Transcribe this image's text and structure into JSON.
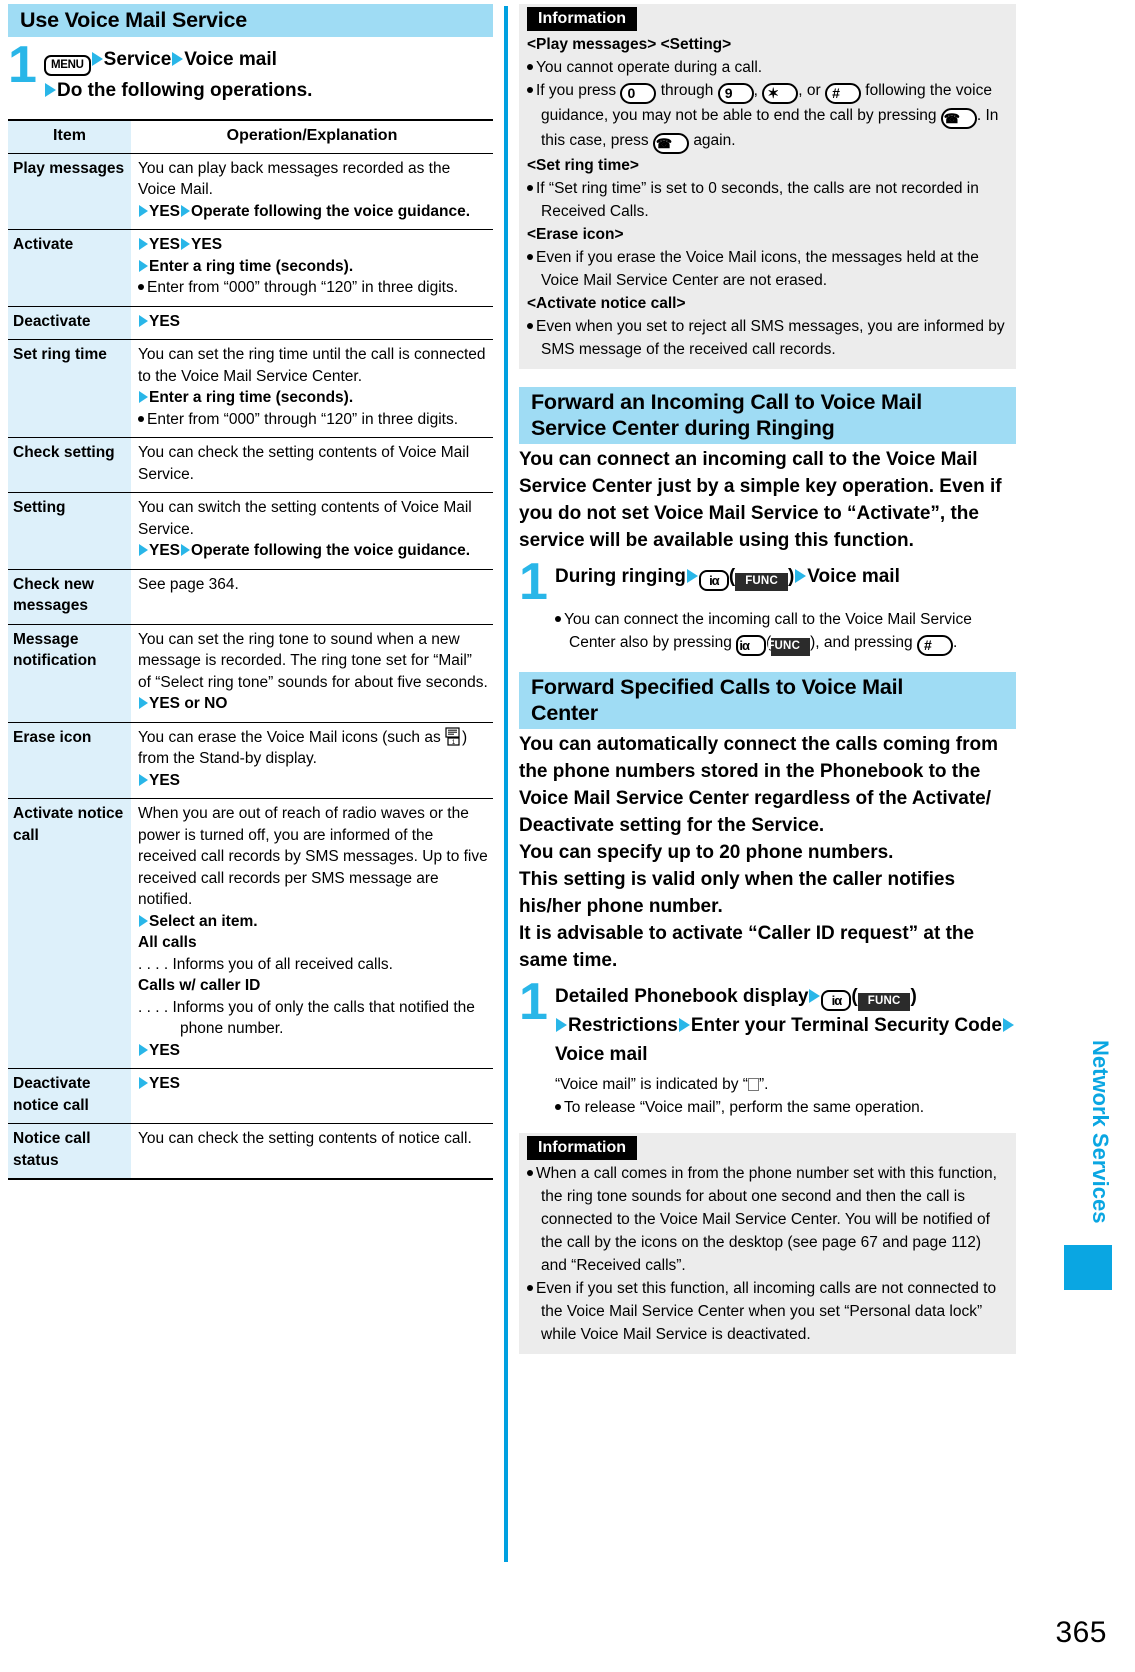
{
  "page_number": "365",
  "side_tab": "Network Services",
  "left": {
    "heading": "Use Voice Mail Service",
    "step1": {
      "number": "1",
      "key_menu": "MENU",
      "part1": "Service",
      "part2": "Voice mail",
      "line2": "Do the following operations."
    },
    "table": {
      "headers": [
        "Item",
        "Operation/Explanation"
      ],
      "rows": [
        {
          "item": "Play messages",
          "lines": [
            {
              "type": "text",
              "text": "You can play back messages recorded as the Voice Mail."
            },
            {
              "type": "arrow-bold",
              "text": "YES"
            },
            {
              "type": "arrow-bold-cont",
              "text": "Operate following the voice guidance."
            }
          ]
        },
        {
          "item": "Activate",
          "lines": [
            {
              "type": "arrow-bold",
              "text": "YES"
            },
            {
              "type": "arrow-bold-cont",
              "text": "YES"
            },
            {
              "type": "arrow-bold",
              "text": "Enter a ring time (seconds)."
            },
            {
              "type": "bullet",
              "text": "Enter from “000” through “120” in three digits."
            }
          ]
        },
        {
          "item": "Deactivate",
          "lines": [
            {
              "type": "arrow-bold",
              "text": "YES"
            }
          ]
        },
        {
          "item": "Set ring time",
          "lines": [
            {
              "type": "text",
              "text": "You can set the ring time until the call is connected to the Voice Mail Service Center."
            },
            {
              "type": "arrow-bold",
              "text": "Enter a ring time (seconds)."
            },
            {
              "type": "bullet",
              "text": "Enter from “000” through “120” in three digits."
            }
          ]
        },
        {
          "item": "Check setting",
          "lines": [
            {
              "type": "text",
              "text": "You can check the setting contents of Voice Mail Service."
            }
          ]
        },
        {
          "item": "Setting",
          "lines": [
            {
              "type": "text",
              "text": "You can switch the setting contents of Voice Mail Service."
            },
            {
              "type": "arrow-bold",
              "text": "YES"
            },
            {
              "type": "arrow-bold-cont",
              "text": "Operate following the voice guidance."
            }
          ]
        },
        {
          "item": "Check new messages",
          "lines": [
            {
              "type": "text",
              "text": "See page 364."
            }
          ]
        },
        {
          "item": "Message notification",
          "lines": [
            {
              "type": "text",
              "text": "You can set the ring tone to sound when a new message is recorded. The ring tone set for “Mail” of “Select ring tone” sounds for about five seconds."
            },
            {
              "type": "arrow-bold",
              "text": "YES or NO"
            }
          ]
        },
        {
          "item": "Erase icon",
          "lines": [
            {
              "type": "icon-text",
              "pre": "You can erase the Voice Mail icons (such as ",
              "post": ") from the Stand-by display."
            },
            {
              "type": "arrow-bold",
              "text": "YES"
            }
          ]
        },
        {
          "item": "Activate notice call",
          "lines": [
            {
              "type": "text",
              "text": "When you are out of reach of radio waves or the power is turned off, you are informed of the received call records by SMS messages. Up to five received call records per SMS message are notified."
            },
            {
              "type": "arrow-bold",
              "text": "Select an item."
            },
            {
              "type": "bold",
              "text": "All calls"
            },
            {
              "type": "dots",
              "text": "Informs you of all received calls."
            },
            {
              "type": "bold",
              "text": "Calls w/ caller ID"
            },
            {
              "type": "dots2",
              "text": "Informs you of only the calls that notified the phone number."
            },
            {
              "type": "arrow-bold",
              "text": "YES"
            }
          ]
        },
        {
          "item": "Deactivate notice call",
          "lines": [
            {
              "type": "arrow-bold",
              "text": "YES"
            }
          ]
        },
        {
          "item": "Notice call status",
          "lines": [
            {
              "type": "text",
              "text": "You can check the setting contents of notice call."
            }
          ]
        }
      ]
    }
  },
  "right": {
    "info_top": {
      "title": "Information",
      "sub1": "<Play messages> <Setting>",
      "b1": "You cannot operate during a call.",
      "b2_a": "If you press",
      "b2_key0": "0",
      "b2_b": "through",
      "b2_key9": "9",
      "b2_c": ",",
      "b2_keystar": "✶",
      "b2_d": ", or",
      "b2_keyhash": "#",
      "b2_e": "following the voice guidance, you may not be able to end the call by pressing",
      "b2_keyphone": "☎",
      "b2_f": ". In this case, press",
      "b2_keyphone2": "☎",
      "b2_g": "again.",
      "sub2": "<Set ring time>",
      "b3": "If “Set ring time” is set to 0 seconds, the calls are not recorded in Received Calls.",
      "sub3": "<Erase icon>",
      "b4": "Even if you erase the Voice Mail icons, the messages held at the Voice Mail Service Center are not erased.",
      "sub4": "<Activate notice call>",
      "b5": "Even when you set to reject all SMS messages, you are informed by SMS message of the received call records."
    },
    "section2": {
      "heading_line1": "Forward an Incoming Call to Voice Mail",
      "heading_line2": "Service Center during Ringing",
      "lead": "You can connect an incoming call to the Voice Mail Service Center just by a simple key operation. Even if you do not set Voice Mail Service to “Activate”, the service will be available using this function.",
      "step": {
        "number": "1",
        "t1": "During ringing",
        "key_imode": "iα",
        "func": "FUNC",
        "t2": "Voice mail"
      },
      "note_a": "You can connect the incoming call to the Voice Mail Service Center also by pressing",
      "note_func": "FUNC",
      "note_imode": "iα",
      "note_b": ", and pressing",
      "note_key": "#",
      "note_c": "."
    },
    "section3": {
      "heading_line1": "Forward Specified Calls to Voice Mail",
      "heading_line2": "Center",
      "lead1": "You can automatically connect the calls coming from the phone numbers stored in the Phonebook to the Voice Mail Service Center regardless of the Activate/ Deactivate setting for the Service.",
      "lead2": "You can specify up to 20 phone numbers.",
      "lead3": "This setting is valid only when the caller notifies his/her phone number.",
      "lead4": "It is advisable to activate “Caller ID request” at the same time.",
      "step": {
        "number": "1",
        "t1": "Detailed Phonebook display",
        "key_imode": "iα",
        "func": "FUNC",
        "t2": "Restrictions",
        "t3": "Enter your Terminal Security Code",
        "t4": "Voice mail"
      },
      "note_plain_a": "“Voice mail” is indicated by “",
      "note_plain_b": "”.",
      "note_bullet": "To release “Voice mail”, perform the same operation."
    },
    "info_bottom": {
      "title": "Information",
      "b1": "When a call comes in from the phone number set with this function, the ring tone sounds for about one second and then the call is connected to the Voice Mail Service Center. You will be notified of the call by the icons on the desktop (see page 67 and page 112) and “Received calls”.",
      "b2": "Even if you set this function, all incoming calls are not connected to the Voice Mail Service Center when you set “Personal data lock” while Voice Mail Service is deactivated."
    }
  }
}
